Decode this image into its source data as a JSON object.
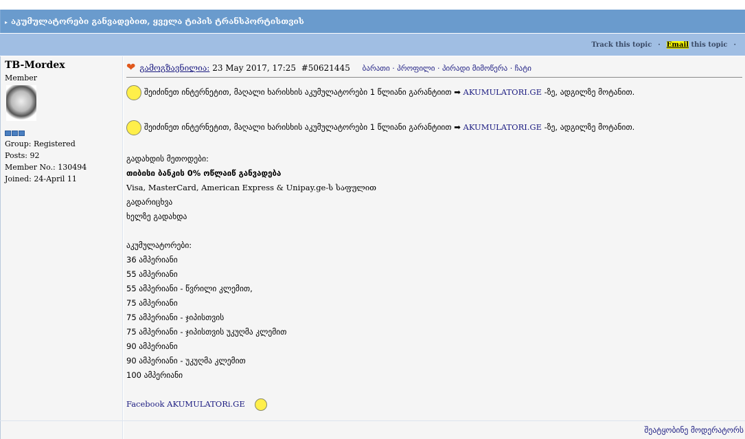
{
  "topic": {
    "title": "აკუმულატორები განვადებით, ყველა ტიპის ტრანსპორტისთვის"
  },
  "toolbar": {
    "track": "Track this topic",
    "email": "Email",
    "email_rest": "this topic",
    "sep": "·"
  },
  "author": {
    "name": "TB-Mordex",
    "rank": "Member",
    "group": "Group: Registered",
    "posts": "Posts: 92",
    "member_no": "Member No.: 130494",
    "joined": "Joined: 24-April 11"
  },
  "post": {
    "sent_label": "გამოგზავნილია:",
    "date": "23 May 2017, 17:25",
    "id": "#50621445",
    "nav": [
      "ბარათი",
      "პროფილი",
      "პირადი მიმოწერა",
      "ჩატი"
    ],
    "promo": {
      "text": "შეიძინეთ ინტერნეტით, მაღალი ხარისხის აკუმულატორები 1 წლიანი გარანტიით ➡",
      "link": "AKUMULATORI.GE",
      "suffix": "-ზე, ადგილზე მოტანით."
    },
    "payment_heading": "გადახდის მეთოდები:",
    "payment_bold": "თიბისი ბანკის 0% ოწლაიწ განვადება",
    "payment_lines": [
      "Visa, MasterCard, American Express & Unipay.ge-ს საფულით",
      "გადარიცხვა",
      "ხელზე გადახდა"
    ],
    "batteries_heading": "აკუმულატორები:",
    "batteries": [
      "36 ამპერიანი",
      "55 ამპერიანი",
      "55 ამპერიანი - წვრილი კლემით,",
      "75 ამპერიანი",
      "75 ამპერიანი - ჯიპისთვის",
      "75 ამპერიანი - ჯიპისთვის უკუღმა კლემით",
      "90 ამპერიანი",
      "90 ამპერიანი - უკუღმა კლემით",
      "100 ამპერიანი"
    ],
    "facebook": "Facebook AKUMULATORi.GE"
  },
  "report": "შეატყობინე მოდერატორს"
}
